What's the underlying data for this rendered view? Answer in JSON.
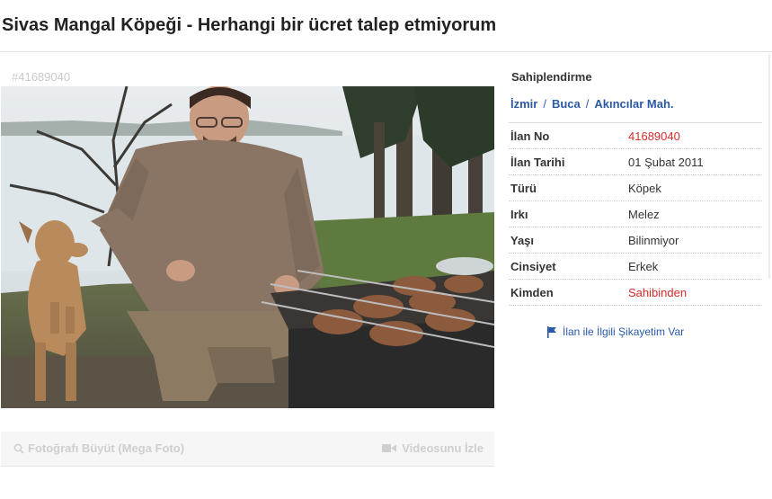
{
  "listing": {
    "title": "Sivas Mangal Köpeği - Herhangi bir ücret talep etmiyorum",
    "id_watermark": "#41689040"
  },
  "photo": {
    "enlarge_label": "Fotoğrafı Büyüt (Mega Foto)",
    "video_label": "Videosunu İzle",
    "icons": {
      "enlarge": "magnifier-icon",
      "video": "video-camera-icon"
    }
  },
  "sidebar": {
    "heading": "Sahiplendirme",
    "breadcrumb": [
      "İzmir",
      "Buca",
      "Akıncılar Mah."
    ],
    "details": [
      {
        "label": "İlan No",
        "value": "41689040",
        "highlight": true
      },
      {
        "label": "İlan Tarihi",
        "value": "01 Şubat 2011",
        "highlight": false
      },
      {
        "label": "Türü",
        "value": "Köpek",
        "highlight": false
      },
      {
        "label": "Irkı",
        "value": "Melez",
        "highlight": false
      },
      {
        "label": "Yaşı",
        "value": "Bilinmiyor",
        "highlight": false
      },
      {
        "label": "Cinsiyet",
        "value": "Erkek",
        "highlight": false
      },
      {
        "label": "Kimden",
        "value": "Sahibinden",
        "highlight": true
      }
    ],
    "complaint_label": "İlan ile İlgili Şikayetim Var",
    "complaint_icon": "flag-icon"
  },
  "colors": {
    "link": "#2a5aa5",
    "highlight": "#d62b2b"
  }
}
